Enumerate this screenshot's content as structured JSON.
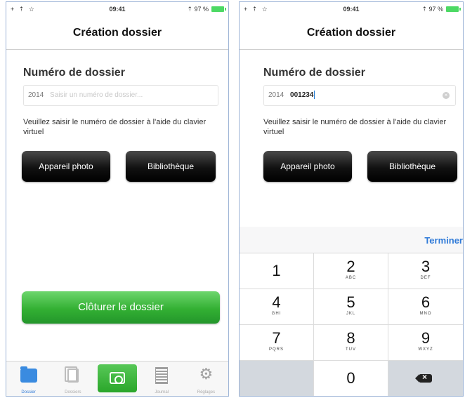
{
  "status_bar": {
    "signal": "+ ⇡ ☆",
    "time": "09:41",
    "battery": "⇡ 97 %"
  },
  "screen_title": "Création dossier",
  "section_title": "Numéro de dossier",
  "folder_input": {
    "year_prefix": "2014",
    "placeholder": "Saisir un numéro de dossier...",
    "value": "001234"
  },
  "helper_text": "Veuillez saisir le numéro de dossier à l'aide du clavier virtuel",
  "buttons": {
    "camera": "Appareil photo",
    "library": "Bibliothèque",
    "close_folder": "Clôturer le dossier"
  },
  "tab_bar": {
    "items": [
      {
        "label": "Dossier",
        "icon": "folder-icon",
        "active": true
      },
      {
        "label": "Dossiers",
        "icon": "pages-icon",
        "active": false
      },
      {
        "label": "",
        "icon": "camera-icon",
        "active": false
      },
      {
        "label": "Journal",
        "icon": "journal-icon",
        "active": false
      },
      {
        "label": "Réglages",
        "icon": "gear-icon",
        "active": false
      }
    ]
  },
  "keyboard": {
    "done_label": "Terminer",
    "keys": [
      {
        "digit": "1",
        "letters": ""
      },
      {
        "digit": "2",
        "letters": "ABC"
      },
      {
        "digit": "3",
        "letters": "DEF"
      },
      {
        "digit": "4",
        "letters": "GHI"
      },
      {
        "digit": "5",
        "letters": "JKL"
      },
      {
        "digit": "6",
        "letters": "MNO"
      },
      {
        "digit": "7",
        "letters": "PQRS"
      },
      {
        "digit": "8",
        "letters": "TUV"
      },
      {
        "digit": "9",
        "letters": "WXYZ"
      },
      {
        "digit": "",
        "letters": ""
      },
      {
        "digit": "0",
        "letters": ""
      },
      {
        "digit": "",
        "letters": ""
      }
    ]
  },
  "colors": {
    "accent_blue": "#2f7ad8",
    "green_button": "#33b033",
    "dark_button": "#111111",
    "phone_border": "#9db4d6"
  }
}
